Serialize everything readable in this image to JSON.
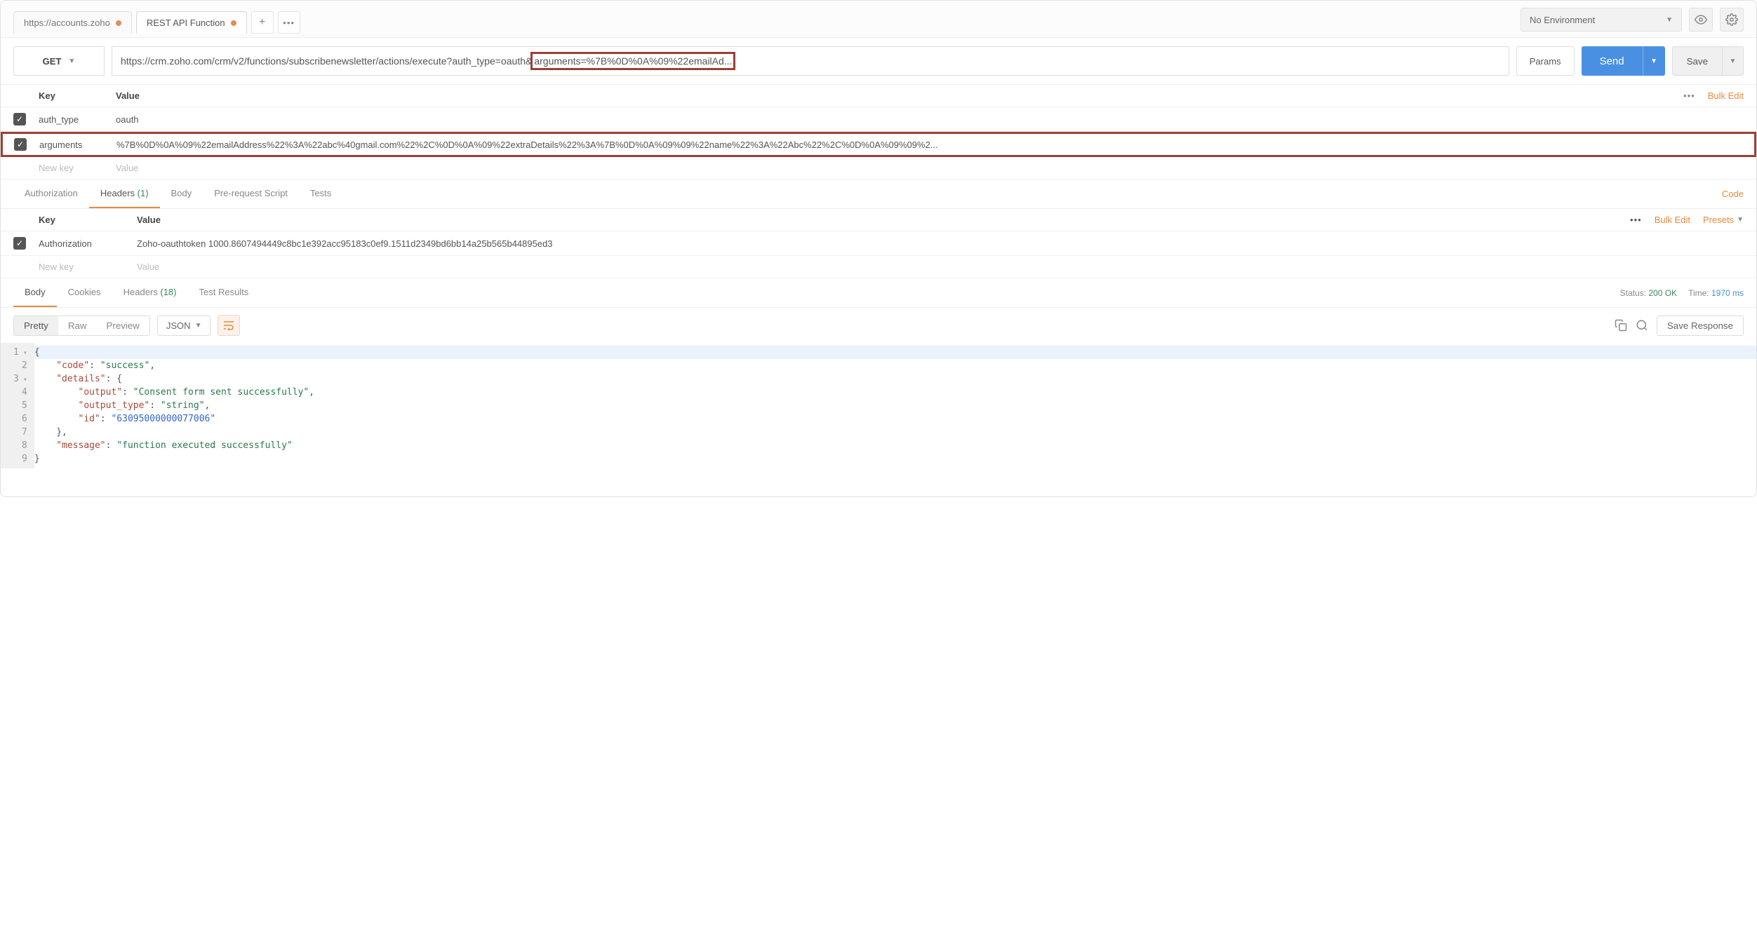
{
  "topbar": {
    "tabs": [
      {
        "label": "https://accounts.zoho",
        "dirty": true
      },
      {
        "label": "REST API Function",
        "dirty": true
      }
    ],
    "environment": "No Environment"
  },
  "request": {
    "method": "GET",
    "url_prefix": "https://crm.zoho.com/crm/v2/functions/subscribenewsletter/actions/execute?auth_type=oauth&",
    "url_highlighted": "arguments=%7B%0D%0A%09%22emailAd...",
    "params_label": "Params",
    "send_label": "Send",
    "save_label": "Save"
  },
  "params": {
    "key_label": "Key",
    "value_label": "Value",
    "bulk_edit": "Bulk Edit",
    "rows": [
      {
        "key": "auth_type",
        "value": "oauth",
        "checked": true
      },
      {
        "key": "arguments",
        "value": "%7B%0D%0A%09%22emailAddress%22%3A%22abc%40gmail.com%22%2C%0D%0A%09%22extraDetails%22%3A%7B%0D%0A%09%09%22name%22%3A%22Abc%22%2C%0D%0A%09%09%2...",
        "checked": true
      }
    ],
    "placeholder_key": "New key",
    "placeholder_value": "Value"
  },
  "req_tabs": {
    "authorization": "Authorization",
    "headers": "Headers",
    "headers_count": "(1)",
    "body": "Body",
    "prerequest": "Pre-request Script",
    "tests": "Tests",
    "code": "Code"
  },
  "headers": {
    "key_label": "Key",
    "value_label": "Value",
    "bulk_edit": "Bulk Edit",
    "presets": "Presets",
    "rows": [
      {
        "key": "Authorization",
        "value": "Zoho-oauthtoken 1000.8607494449c8bc1e392acc95183c0ef9.1511d2349bd6bb14a25b565b44895ed3",
        "checked": true
      }
    ],
    "placeholder_key": "New key",
    "placeholder_value": "Value"
  },
  "resp_tabs": {
    "body": "Body",
    "cookies": "Cookies",
    "headers": "Headers",
    "headers_count": "(18)",
    "test_results": "Test Results",
    "status_label": "Status:",
    "status_value": "200 OK",
    "time_label": "Time:",
    "time_value": "1970 ms"
  },
  "resp_toolbar": {
    "pretty": "Pretty",
    "raw": "Raw",
    "preview": "Preview",
    "format": "JSON",
    "save_response": "Save Response"
  },
  "response_body": {
    "code": "success",
    "details": {
      "output": "Consent form sent successfully",
      "output_type": "string",
      "id": "63095000000077006"
    },
    "message": "function executed successfully"
  }
}
